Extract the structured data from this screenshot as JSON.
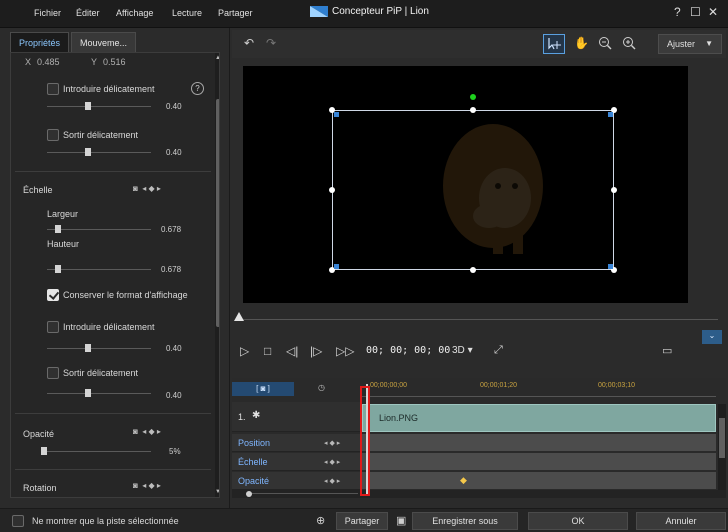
{
  "menu": {
    "items": [
      "Fichier",
      "Éditer",
      "Affichage",
      "Lecture",
      "Partager"
    ],
    "title": "Concepteur PiP | Lion",
    "window_controls": [
      "?",
      "☐",
      "✕"
    ]
  },
  "left_panel": {
    "tabs": [
      "Propriétés",
      "Mouveme..."
    ],
    "position": {
      "x_label": "X",
      "x_value": "0.485",
      "y_label": "Y",
      "y_value": "0.516"
    },
    "fade_in_1": {
      "label": "Introduire délicatement",
      "value": "0.40"
    },
    "fade_out_1": {
      "label": "Sortir délicatement",
      "value": "0.40"
    },
    "scale": {
      "label": "Échelle",
      "width_label": "Largeur",
      "width_value": "0.678",
      "height_label": "Hauteur",
      "height_value": "0.678",
      "keep_ratio_label": "Conserver le format d'affichage"
    },
    "fade_in_2": {
      "label": "Introduire délicatement",
      "value": "0.40"
    },
    "fade_out_2": {
      "label": "Sortir délicatement",
      "value": "0.40"
    },
    "opacity": {
      "label": "Opacité",
      "value": "5%"
    },
    "rotation": {
      "label": "Rotation"
    }
  },
  "toolbar": {
    "undo_icon": "↶",
    "redo_icon": "↷",
    "ajuster_label": "Ajuster"
  },
  "playback": {
    "timecode": "00; 00; 00; 00",
    "three_d_label": "3D"
  },
  "timeline": {
    "ruler_times": [
      "00;00;00;00",
      "00;00;01;20",
      "00;00;03;10"
    ],
    "track_number": "1.",
    "clip_name": "Lion.PNG",
    "tracks": [
      "Position",
      "Échelle",
      "Opacité"
    ]
  },
  "bottom": {
    "show_selected_label": "Ne montrer que la piste sélectionnée",
    "share_label": "Partager",
    "save_as_label": "Enregistrer sous",
    "ok_label": "OK",
    "cancel_label": "Annuler"
  },
  "colors": {
    "accent_blue": "#3b86d8",
    "clip_teal": "#7fa7a0",
    "highlight_red": "#e01a1a",
    "anchor_green": "#1ed11e"
  }
}
